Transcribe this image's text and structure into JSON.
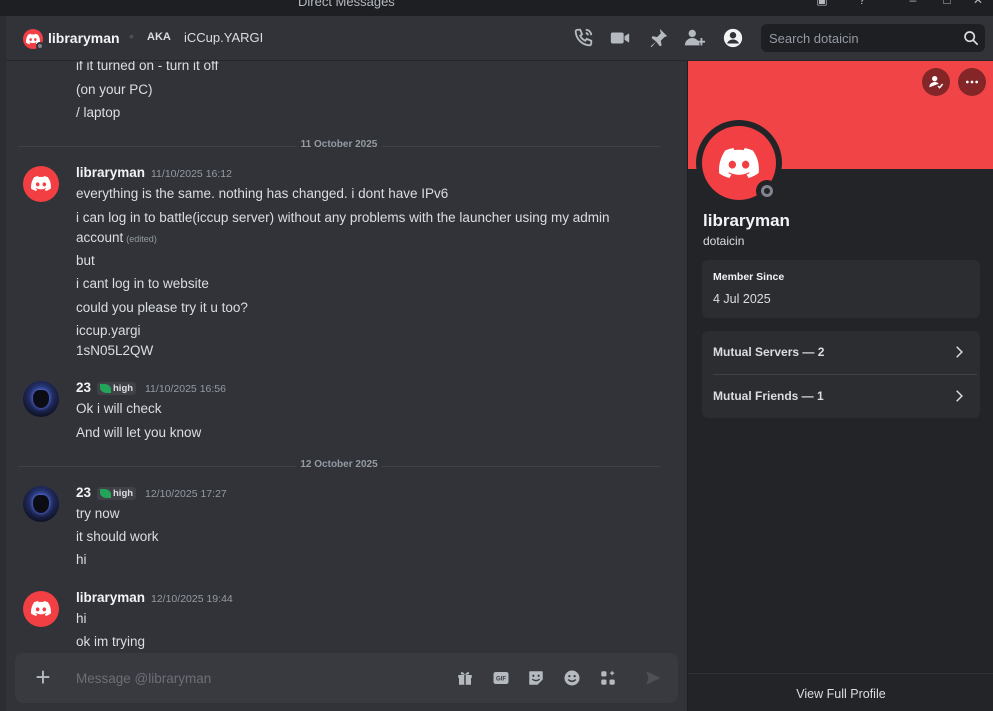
{
  "window": {
    "title": "Direct Messages"
  },
  "header": {
    "name": "libraryman",
    "aka_label": "AKA",
    "aka_name": "iCCup.YARGI",
    "search_placeholder": "Search dotaicin"
  },
  "messages": {
    "top_lines": [
      "if it turned on - turn it off",
      "(on your PC)",
      "/ laptop"
    ],
    "dividers": [
      "11 October 2025",
      "12 October 2025"
    ],
    "groups": [
      {
        "author": "libraryman",
        "time": "11/10/2025 16:12",
        "lines": [
          "everything is the same. nothing has changed. i dont have IPv6",
          "i can log in to battle(iccup server) without any problems with the launcher using my admin",
          "account",
          "but",
          "i cant log in to website",
          "could you please try it u too?",
          "iccup.yargi",
          "1sN05L2QW"
        ],
        "edited": "(edited)"
      },
      {
        "author": "23",
        "tag": "high",
        "time": "11/10/2025 16:56",
        "lines": [
          "Ok i will check",
          "And will let you know"
        ]
      },
      {
        "author": "23",
        "tag": "high",
        "time": "12/10/2025 17:27",
        "lines": [
          "try now",
          "it should work",
          "hi"
        ]
      },
      {
        "author": "libraryman",
        "time": "12/10/2025 19:44",
        "lines": [
          "hi",
          "ok im trying"
        ]
      }
    ]
  },
  "composer": {
    "placeholder": "Message @libraryman"
  },
  "profile": {
    "name": "libraryman",
    "username": "dotaicin",
    "member_since_label": "Member Since",
    "member_since": "4 Jul 2025",
    "mutual_servers": "Mutual Servers — 2",
    "mutual_friends": "Mutual Friends — 1",
    "view_full": "View Full Profile"
  },
  "colors": {
    "accent_red": "#f23f43",
    "banner": "#f04447",
    "background": "#313338",
    "panel": "#232428"
  }
}
